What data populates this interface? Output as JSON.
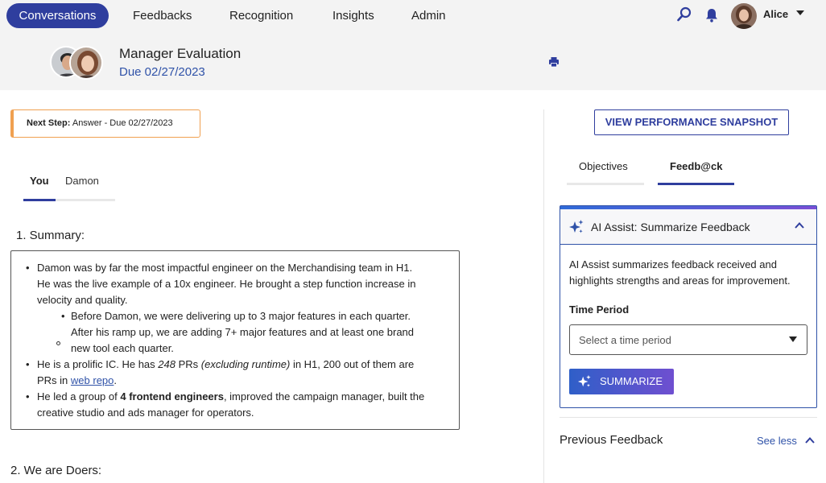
{
  "nav": {
    "items": [
      {
        "label": "Conversations",
        "active": true
      },
      {
        "label": "Feedbacks"
      },
      {
        "label": "Recognition"
      },
      {
        "label": "Insights"
      },
      {
        "label": "Admin"
      }
    ],
    "user_name": "Alice"
  },
  "header": {
    "title": "Manager Evaluation",
    "due": "Due 02/27/2023"
  },
  "next_step": {
    "label": "Next Step:",
    "text": " Answer - Due 02/27/2023"
  },
  "tabs": [
    "You",
    "Damon"
  ],
  "question1": {
    "label": "1. Summary:",
    "lines": {
      "b1_l1": "Damon was by far the most impactful engineer on the Merchandising team in H1.",
      "b1_l2": "He was the live example of a 10x engineer. He brought a step function increase in",
      "b1_l3": "velocity and quality.",
      "sub_l1": "Before Damon, we were delivering up to 3 major features in each quarter.",
      "sub_l2": "After his ramp up, we are adding 7+ major features and at least one brand",
      "sub_l3": "new tool each quarter.",
      "b2_a": "He is a prolific IC. He has ",
      "b2_b": "248",
      "b2_c": " PRs ",
      "b2_d": "(excluding runtime)",
      "b2_e": " in H1, 200 out of them are",
      "b2_l2_a": "PRs in ",
      "b2_link": "web repo",
      "b2_l2_b": ".",
      "b3_a": "He led a group of ",
      "b3_b": "4 frontend engineers",
      "b3_c": ", improved the campaign manager, built the",
      "b3_l2": "creative studio and ads manager for operators."
    }
  },
  "question2": {
    "label": "2. We are Doers:"
  },
  "right": {
    "perf_button": "VIEW PERFORMANCE SNAPSHOT",
    "tabs": [
      "Objectives",
      "Feedb@ck"
    ],
    "ai": {
      "title": "AI Assist: Summarize Feedback",
      "desc_l1": "AI Assist summarizes feedback received and",
      "desc_l2": "highlights strengths and areas for improvement.",
      "time_label": "Time Period",
      "select_placeholder": "Select a time period",
      "button": "SUMMARIZE"
    },
    "previous_feedback": "Previous Feedback",
    "see_less": "See less"
  },
  "colors": {
    "primary": "#2f3e9e",
    "link": "#2f52a8",
    "next_step_border": "#f0a050",
    "nav_bg": "#f3f3f3"
  }
}
